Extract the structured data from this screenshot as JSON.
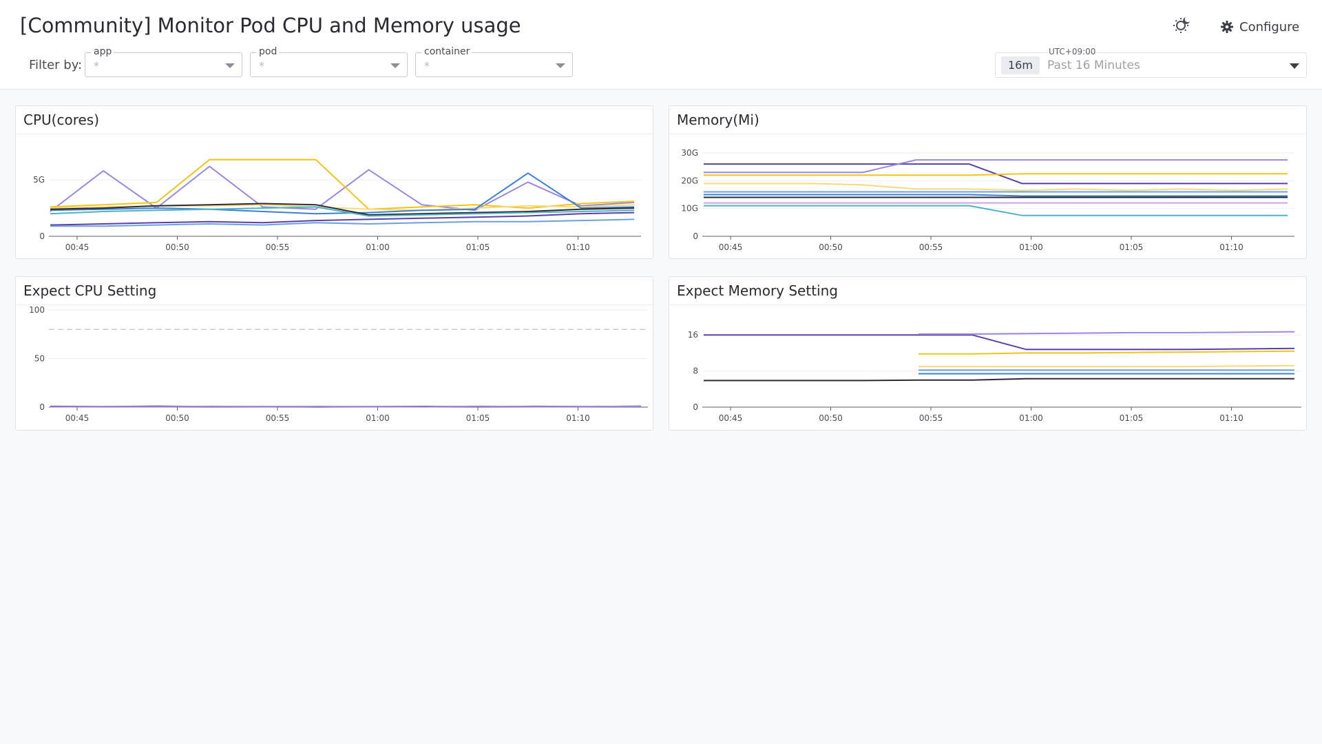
{
  "page": {
    "title": "[Community] Monitor Pod CPU and Memory usage"
  },
  "toolbar": {
    "theme_icon": "theme-toggle-icon",
    "configure_label": "Configure",
    "configure_icon": "gear-icon"
  },
  "filters": {
    "label": "Filter by:",
    "items": [
      {
        "name": "app",
        "value": "*"
      },
      {
        "name": "pod",
        "value": "*"
      },
      {
        "name": "container",
        "value": "*"
      }
    ]
  },
  "time_range": {
    "timezone": "UTC+09:00",
    "short": "16m",
    "label": "Past 16 Minutes"
  },
  "colors": {
    "palette": [
      "#5b3fa8",
      "#9b86e0",
      "#f0c419",
      "#f7d97a",
      "#6a9fe0",
      "#3d7fd4",
      "#2b2b33",
      "#4fb2c4",
      "#c8a3f0"
    ],
    "grid": "#eceef2",
    "axis": "#7a7d85"
  },
  "panels": [
    {
      "title": "CPU(cores)",
      "chart_data": {
        "type": "line",
        "x_ticks": [
          "00:45",
          "00:50",
          "00:55",
          "01:00",
          "01:05",
          "01:10"
        ],
        "y_ticks": [
          "0",
          "5G"
        ],
        "ylim": [
          0,
          8
        ],
        "series": [
          {
            "values": [
              1.0,
              1.1,
              1.2,
              1.3,
              1.2,
              1.4,
              1.5,
              1.6,
              1.7,
              1.8,
              2.0,
              2.1
            ]
          },
          {
            "values": [
              2.2,
              5.8,
              2.5,
              6.2,
              2.6,
              2.4,
              5.9,
              2.8,
              2.3,
              4.8,
              2.7,
              3.0
            ]
          },
          {
            "values": [
              2.6,
              2.8,
              3.0,
              6.8,
              6.8,
              6.8,
              2.4,
              2.6,
              2.8,
              2.5,
              2.9,
              3.1
            ]
          },
          {
            "values": [
              2.5,
              2.6,
              2.7,
              2.7,
              2.8,
              2.6,
              2.4,
              2.3,
              2.5,
              2.7,
              2.6,
              2.8
            ]
          },
          {
            "values": [
              0.9,
              0.9,
              1.0,
              1.1,
              1.0,
              1.2,
              1.1,
              1.2,
              1.3,
              1.3,
              1.4,
              1.5
            ]
          },
          {
            "values": [
              2.3,
              2.4,
              2.5,
              2.4,
              2.2,
              2.0,
              2.1,
              2.3,
              2.4,
              5.6,
              2.5,
              2.6
            ]
          },
          {
            "values": [
              2.4,
              2.5,
              2.7,
              2.8,
              2.9,
              2.8,
              1.9,
              2.0,
              2.1,
              2.2,
              2.4,
              2.5
            ]
          },
          {
            "values": [
              2.0,
              2.2,
              2.3,
              2.4,
              2.5,
              2.6,
              1.8,
              1.9,
              2.0,
              2.1,
              2.2,
              2.3
            ]
          }
        ]
      }
    },
    {
      "title": "Memory(Mi)",
      "chart_data": {
        "type": "line",
        "x_ticks": [
          "00:45",
          "00:50",
          "00:55",
          "01:00",
          "01:05",
          "01:10"
        ],
        "y_ticks": [
          "0",
          "10G",
          "20G",
          "30G"
        ],
        "ylim": [
          0,
          30
        ],
        "series": [
          {
            "values": [
              26,
              26,
              26,
              26,
              26,
              26,
              19,
              19,
              19,
              19,
              19,
              19
            ]
          },
          {
            "values": [
              23,
              23,
              23,
              23,
              27.5,
              27.5,
              27.5,
              27.5,
              27.5,
              27.5,
              27.5,
              27.5
            ]
          },
          {
            "values": [
              22,
              22,
              22,
              22,
              22,
              22,
              22.5,
              22.5,
              22.5,
              22.5,
              22.5,
              22.5
            ]
          },
          {
            "values": [
              19,
              19,
              19,
              18.5,
              17,
              17,
              16.5,
              17,
              16.5,
              17,
              16.5,
              17
            ]
          },
          {
            "values": [
              16,
              16,
              16,
              16,
              16,
              16,
              16,
              16,
              16,
              16,
              16,
              16
            ]
          },
          {
            "values": [
              15,
              15,
              15,
              15,
              15,
              15,
              14.5,
              14.5,
              14.5,
              14.5,
              14.5,
              14.5
            ]
          },
          {
            "values": [
              14,
              14,
              14,
              14,
              14,
              14,
              14,
              14,
              14,
              14,
              14,
              14
            ]
          },
          {
            "values": [
              11,
              11,
              11,
              11,
              11,
              11,
              7.5,
              7.5,
              7.5,
              7.5,
              7.5,
              7.5
            ]
          },
          {
            "values": [
              12,
              12,
              12,
              12,
              12,
              12,
              12,
              12,
              12,
              12,
              12,
              12
            ]
          }
        ]
      }
    },
    {
      "title": "Expect CPU Setting",
      "chart_data": {
        "type": "line",
        "x_ticks": [
          "00:45",
          "00:50",
          "00:55",
          "01:00",
          "01:05",
          "01:10"
        ],
        "y_ticks": [
          "0",
          "50",
          "100"
        ],
        "ylim": [
          0,
          100
        ],
        "threshold": 80,
        "series": [
          {
            "values": [
              0.8,
              0.5,
              1.0,
              0.4,
              0.6,
              0.3,
              0.5,
              0.7,
              0.4,
              0.8,
              0.5,
              1.0
            ]
          },
          {
            "values": [
              0.3,
              0.6,
              0.4,
              0.8,
              0.5,
              0.7,
              0.4,
              0.3,
              0.9,
              0.4,
              0.6,
              0.8
            ]
          }
        ]
      }
    },
    {
      "title": "Expect Memory Setting",
      "chart_data": {
        "type": "line",
        "x_ticks": [
          "00:45",
          "00:50",
          "00:55",
          "01:00",
          "01:05",
          "01:10"
        ],
        "y_ticks": [
          "0",
          "8",
          "16"
        ],
        "ylim": [
          0,
          20
        ],
        "series": [
          {
            "values": [
              16,
              16,
              16,
              16,
              16,
              16,
              12.8,
              12.8,
              12.8,
              12.8,
              12.9,
              13
            ]
          },
          {
            "values": [
              null,
              null,
              null,
              null,
              16.2,
              16.2,
              16.3,
              16.4,
              16.5,
              16.5,
              16.6,
              16.7
            ]
          },
          {
            "values": [
              null,
              null,
              null,
              null,
              11.8,
              11.8,
              12,
              12,
              12.1,
              12.2,
              12.3,
              12.4
            ]
          },
          {
            "values": [
              null,
              null,
              null,
              null,
              9,
              9,
              9,
              9,
              9,
              9,
              9.1,
              9.2
            ]
          },
          {
            "values": [
              null,
              null,
              null,
              null,
              8.2,
              8.2,
              8.2,
              8.2,
              8.2,
              8.2,
              8.2,
              8.2
            ]
          },
          {
            "values": [
              null,
              null,
              null,
              null,
              7.4,
              7.4,
              7.4,
              7.4,
              7.4,
              7.4,
              7.4,
              7.4
            ]
          },
          {
            "values": [
              5.9,
              5.9,
              5.9,
              5.9,
              6,
              6,
              6.3,
              6.3,
              6.3,
              6.3,
              6.3,
              6.3
            ]
          }
        ]
      }
    }
  ]
}
